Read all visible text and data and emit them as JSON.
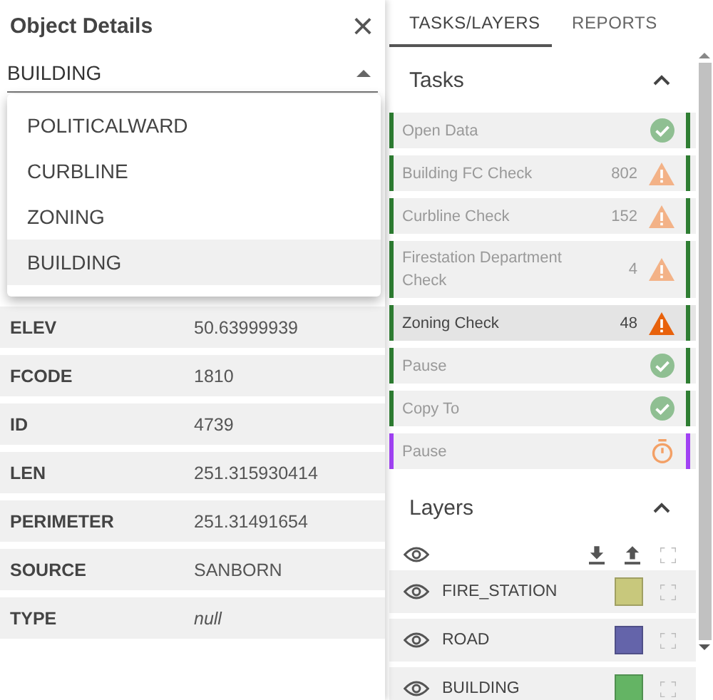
{
  "details": {
    "title": "Object Details",
    "close": "×",
    "select": {
      "value": "BUILDING",
      "expanded": true
    },
    "options": [
      {
        "label": "POLITICALWARD",
        "selected": false
      },
      {
        "label": "CURBLINE",
        "selected": false
      },
      {
        "label": "ZONING",
        "selected": false
      },
      {
        "label": "BUILDING",
        "selected": true
      }
    ],
    "attributes": [
      {
        "name": "ELEV",
        "value": "50.63999939",
        "kind": "text"
      },
      {
        "name": "FCODE",
        "value": "1810",
        "kind": "text"
      },
      {
        "name": "ID",
        "value": "4739",
        "kind": "text"
      },
      {
        "name": "LEN",
        "value": "251.315930414",
        "kind": "text"
      },
      {
        "name": "PERIMETER",
        "value": "251.31491654",
        "kind": "text"
      },
      {
        "name": "SOURCE",
        "value": "SANBORN",
        "kind": "text"
      },
      {
        "name": "TYPE",
        "value": "null",
        "kind": "null"
      }
    ]
  },
  "tabs": [
    {
      "label": "TASKS/LAYERS",
      "selected": true
    },
    {
      "label": "REPORTS",
      "selected": false
    }
  ],
  "tasks": {
    "title": "Tasks",
    "expanded": true,
    "items": [
      {
        "label": "Open Data",
        "kind": "ok",
        "color": "#2e7d32",
        "selected": false
      },
      {
        "label": "Building FC Check",
        "count": "802",
        "kind": "warning",
        "color": "#2e7d32",
        "selected": false
      },
      {
        "label": "Curbline Check",
        "count": "152",
        "kind": "warning",
        "color": "#2e7d32",
        "selected": false
      },
      {
        "label": "Firestation Department Check",
        "count": "4",
        "kind": "warning",
        "color": "#2e7d32",
        "selected": false
      },
      {
        "label": "Zoning Check",
        "count": "48",
        "kind": "error",
        "color": "#2e7d32",
        "selected": true
      },
      {
        "label": "Pause",
        "kind": "ok",
        "color": "#2e7d32",
        "selected": false
      },
      {
        "label": "Copy To",
        "kind": "ok",
        "color": "#2e7d32",
        "selected": false
      },
      {
        "label": "Pause",
        "kind": "timer",
        "color": "#a142f4",
        "selected": false
      }
    ]
  },
  "layers": {
    "title": "Layers",
    "expanded": true,
    "items": [
      {
        "name": "FIRE_STATION",
        "color": "#c8c87c"
      },
      {
        "name": "ROAD",
        "color": "#6464aa"
      },
      {
        "name": "BUILDING",
        "color": "#64b464"
      }
    ]
  }
}
